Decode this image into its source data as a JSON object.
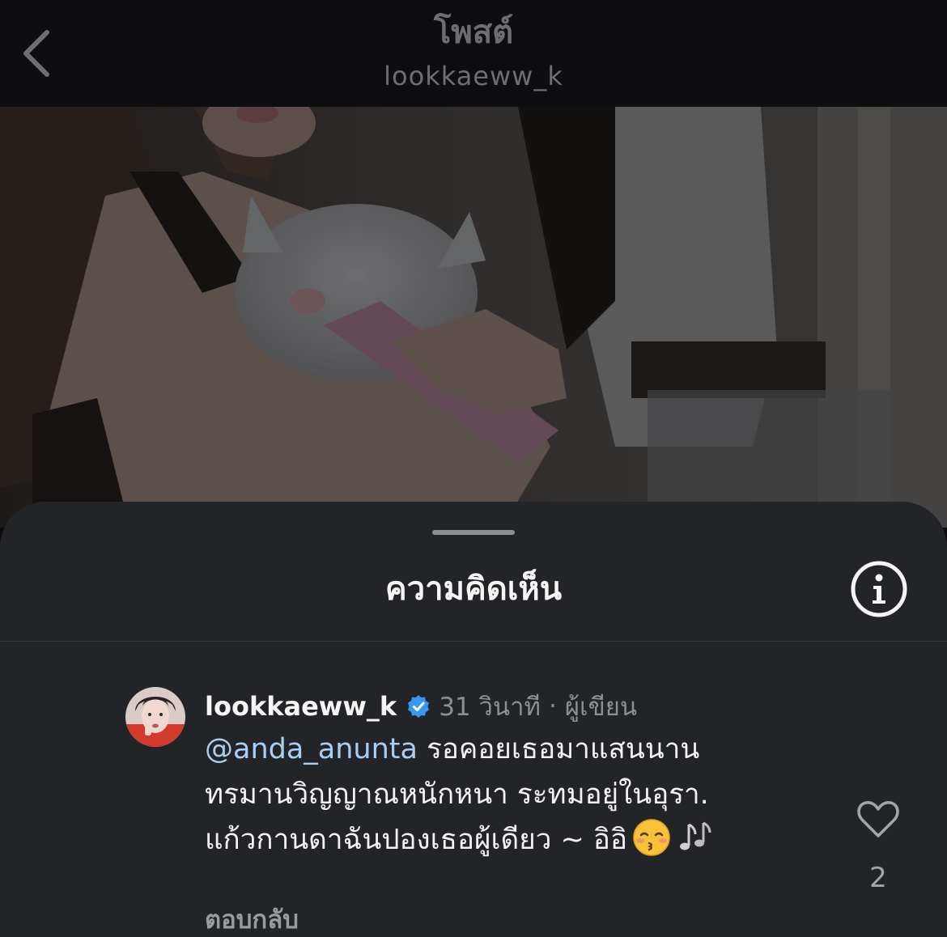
{
  "nav": {
    "title": "โพสต์",
    "subtitle": "lookkaeww_k",
    "back_icon": "chevron-left-icon"
  },
  "sheet": {
    "title": "ความคิดเห็น",
    "info_icon": "info-icon"
  },
  "comment": {
    "username": "lookkaeww_k",
    "verified": true,
    "time": "31 วินาที",
    "separator": "·",
    "role": "ผู้เขียน",
    "mention": "@anda_anunta",
    "line1_rest": " รอคอยเธอมาแสนนาน",
    "line2": "ทรมานวิญญาณหนักหนา ระทมอยู่ในอุรา.",
    "line3": "แก้วกานดาฉันปองเธอผู้เดียว ~ อิอิ",
    "emojis": [
      "kissing-face-icon",
      "music-notes-icon"
    ],
    "reply_label": "ตอบกลับ",
    "like_count": "2",
    "like_icon": "heart-outline-icon"
  },
  "colors": {
    "background": "#0e0e10",
    "sheet": "#222428",
    "text_primary": "#f5f5f5",
    "text_secondary": "#8e8f93",
    "mention": "#a8cff2",
    "verified_badge": "#3897f0"
  }
}
